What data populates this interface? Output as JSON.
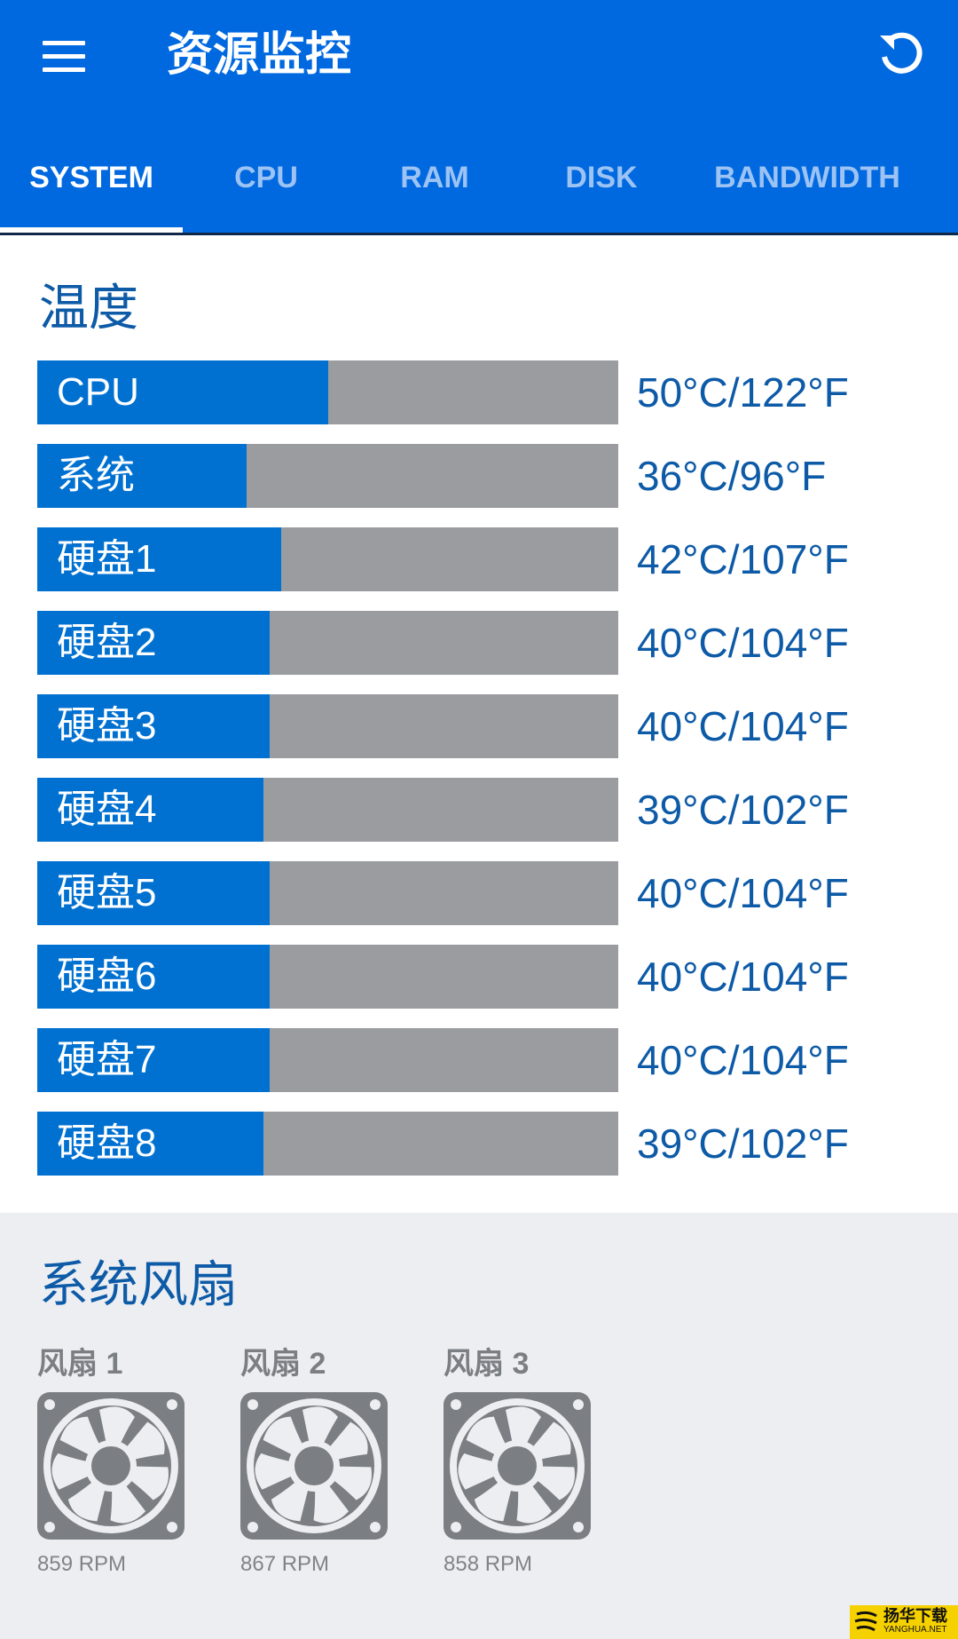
{
  "app": {
    "title": "资源监控",
    "menu_icon": "hamburger-menu-icon",
    "refresh_icon": "refresh-icon"
  },
  "tabs": [
    {
      "label": "SYSTEM",
      "active": true
    },
    {
      "label": "CPU",
      "active": false
    },
    {
      "label": "RAM",
      "active": false
    },
    {
      "label": "DISK",
      "active": false
    },
    {
      "label": "BANDWIDTH",
      "active": false
    }
  ],
  "temperature": {
    "title": "温度",
    "items": [
      {
        "label": "CPU",
        "celsius": 50,
        "display": "50°C/122°F"
      },
      {
        "label": "系统",
        "celsius": 36,
        "display": "36°C/96°F"
      },
      {
        "label": "硬盘1",
        "celsius": 42,
        "display": "42°C/107°F"
      },
      {
        "label": "硬盘2",
        "celsius": 40,
        "display": "40°C/104°F"
      },
      {
        "label": "硬盘3",
        "celsius": 40,
        "display": "40°C/104°F"
      },
      {
        "label": "硬盘4",
        "celsius": 39,
        "display": "39°C/102°F"
      },
      {
        "label": "硬盘5",
        "celsius": 40,
        "display": "40°C/104°F"
      },
      {
        "label": "硬盘6",
        "celsius": 40,
        "display": "40°C/104°F"
      },
      {
        "label": "硬盘7",
        "celsius": 40,
        "display": "40°C/104°F"
      },
      {
        "label": "硬盘8",
        "celsius": 39,
        "display": "39°C/102°F"
      }
    ],
    "bar_max_celsius": 100
  },
  "fans": {
    "title": "系统风扇",
    "items": [
      {
        "name": "风扇 1",
        "rpm": "859 RPM"
      },
      {
        "name": "风扇 2",
        "rpm": "867 RPM"
      },
      {
        "name": "风扇 3",
        "rpm": "858 RPM"
      }
    ]
  },
  "colors": {
    "primary": "#0169e0",
    "bar_fill": "#0171d1",
    "bar_track": "#9a9ca0",
    "heading": "#0d5aa7",
    "fan_gray": "#7b7e82"
  },
  "watermark": {
    "title": "扬华下载",
    "subtitle": "YANGHUA.NET"
  }
}
